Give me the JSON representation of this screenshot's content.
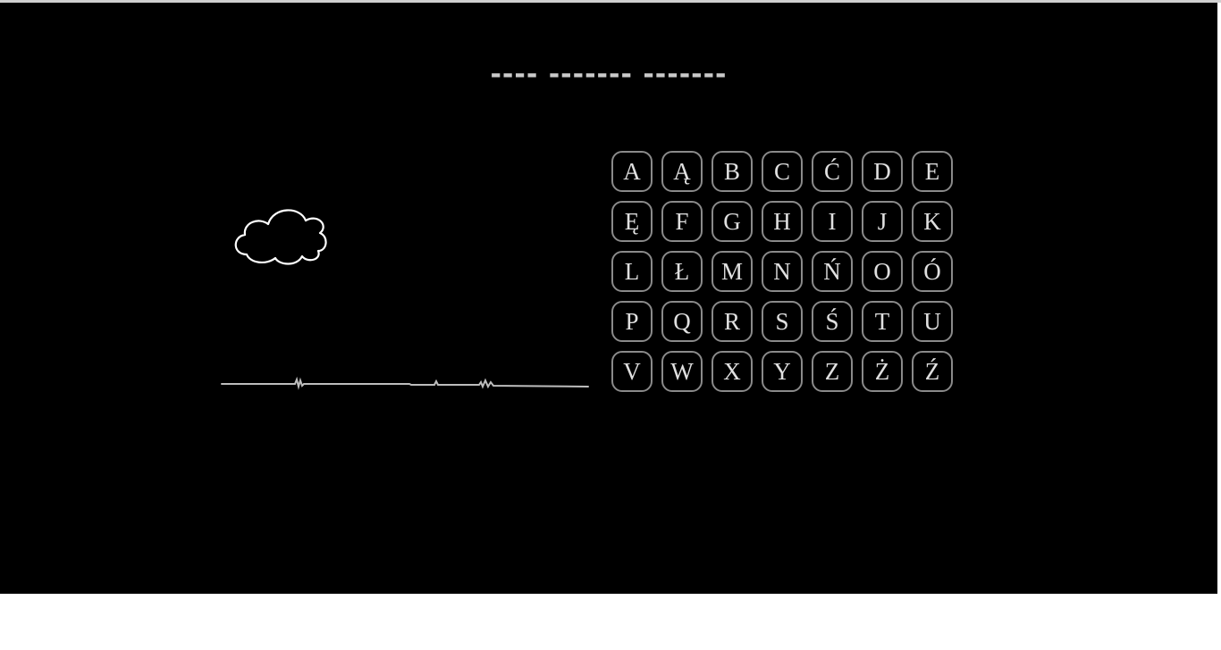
{
  "puzzle": {
    "masked_phrase": "---- ------- -------"
  },
  "alphabet": {
    "letters": [
      "A",
      "Ą",
      "B",
      "C",
      "Ć",
      "D",
      "E",
      "Ę",
      "F",
      "G",
      "H",
      "I",
      "J",
      "K",
      "L",
      "Ł",
      "M",
      "N",
      "Ń",
      "O",
      "Ó",
      "P",
      "Q",
      "R",
      "S",
      "Ś",
      "T",
      "U",
      "V",
      "W",
      "X",
      "Y",
      "Z",
      "Ż",
      "Ź"
    ]
  },
  "colors": {
    "background": "#000000",
    "text": "#c9c9c9",
    "button_border": "#8a8a8a",
    "drawing": "#ffffff"
  },
  "icons": {
    "cloud": "cloud-icon",
    "ground": "ground-line"
  }
}
